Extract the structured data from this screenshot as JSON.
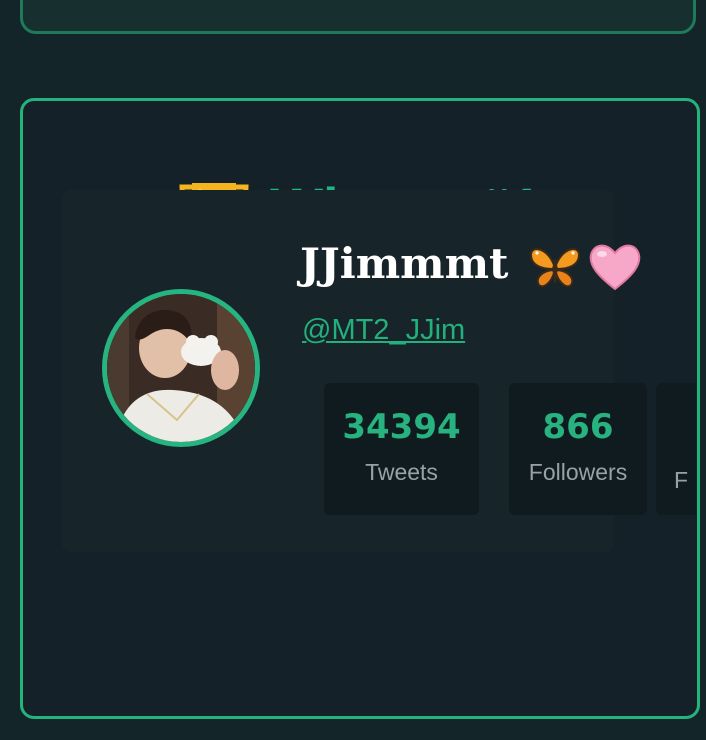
{
  "winner": {
    "title": "Winner #1",
    "trophy_icon": "trophy-icon"
  },
  "user": {
    "display_name": "JJimmmt",
    "name_emojis": [
      "butterfly-icon",
      "pink-heart-icon"
    ],
    "handle": "@MT2_JJim",
    "avatar": "profile-photo"
  },
  "stats": [
    {
      "value": "34394",
      "label": "Tweets"
    },
    {
      "value": "866",
      "label": "Followers"
    },
    {
      "value": "",
      "label": "F"
    }
  ],
  "colors": {
    "accent": "#25b37c",
    "background": "#14252a",
    "card": "#152128",
    "stat_box": "#0f1b1f",
    "label": "#98a2a6"
  }
}
